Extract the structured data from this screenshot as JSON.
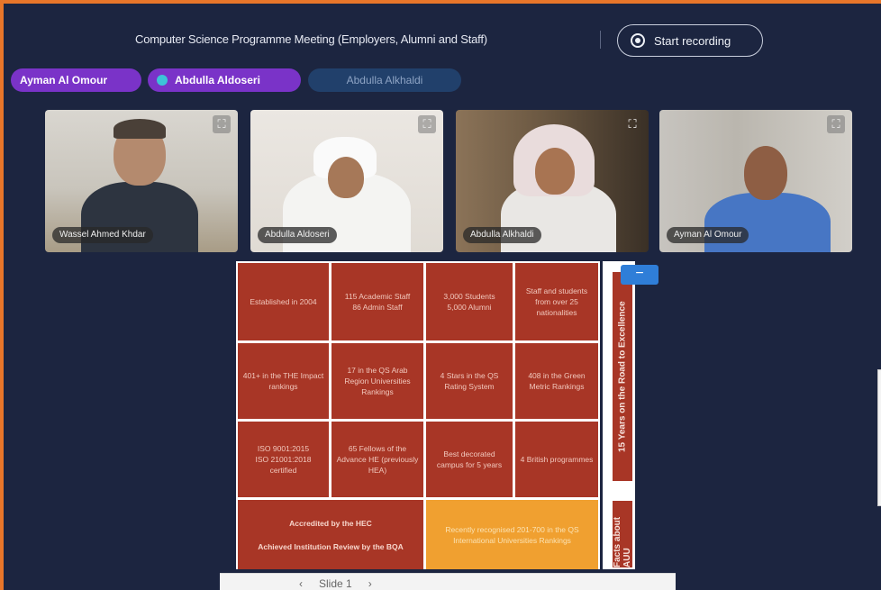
{
  "meeting": {
    "title": "Computer Science Programme Meeting (Employers, Alumni and Staff)",
    "record_label": "Start recording"
  },
  "participants_bar": [
    {
      "name": "Ayman Al Omour"
    },
    {
      "name": "Abdulla Aldoseri"
    },
    {
      "name": "Abdulla Alkhaldi"
    }
  ],
  "video_tiles": [
    {
      "name": "Wassel Ahmed Khdar"
    },
    {
      "name": "Abdulla Aldoseri"
    },
    {
      "name": "Abdulla Alkhaldi"
    },
    {
      "name": "Ayman Al Omour"
    }
  ],
  "slide": {
    "cells": [
      "Established in 2004",
      "115 Academic Staff\n86 Admin Staff",
      "3,000 Students\n5,000 Alumni",
      "Staff and students from over 25 nationalities",
      "401+ in the THE Impact rankings",
      "17 in the QS Arab Region Universities Rankings",
      "4 Stars in the QS Rating System",
      "408 in the Green Metric Rankings",
      "ISO 9001:2015\nISO 21001:2018 certified",
      "65 Fellows of the Advance HE (previously HEA)",
      "Best decorated campus for 5 years",
      "4 British programmes"
    ],
    "accreditation_title": "Accredited by the HEC",
    "accreditation_sub": "Achieved Institution Review by the BQA",
    "yellow_cell": "Recently recognised 201-700 in the QS International Universities Rankings",
    "vertical_banner": "15 Years on the Road to Excellence",
    "vertical_facts": "Facts about AUU",
    "minus_label": "−"
  },
  "toolbar": {
    "prev": "‹",
    "slide_label": "Slide 1",
    "next": "›"
  },
  "icons": {
    "expand": "⛶",
    "record": "record-icon",
    "mic": "mic-icon"
  }
}
